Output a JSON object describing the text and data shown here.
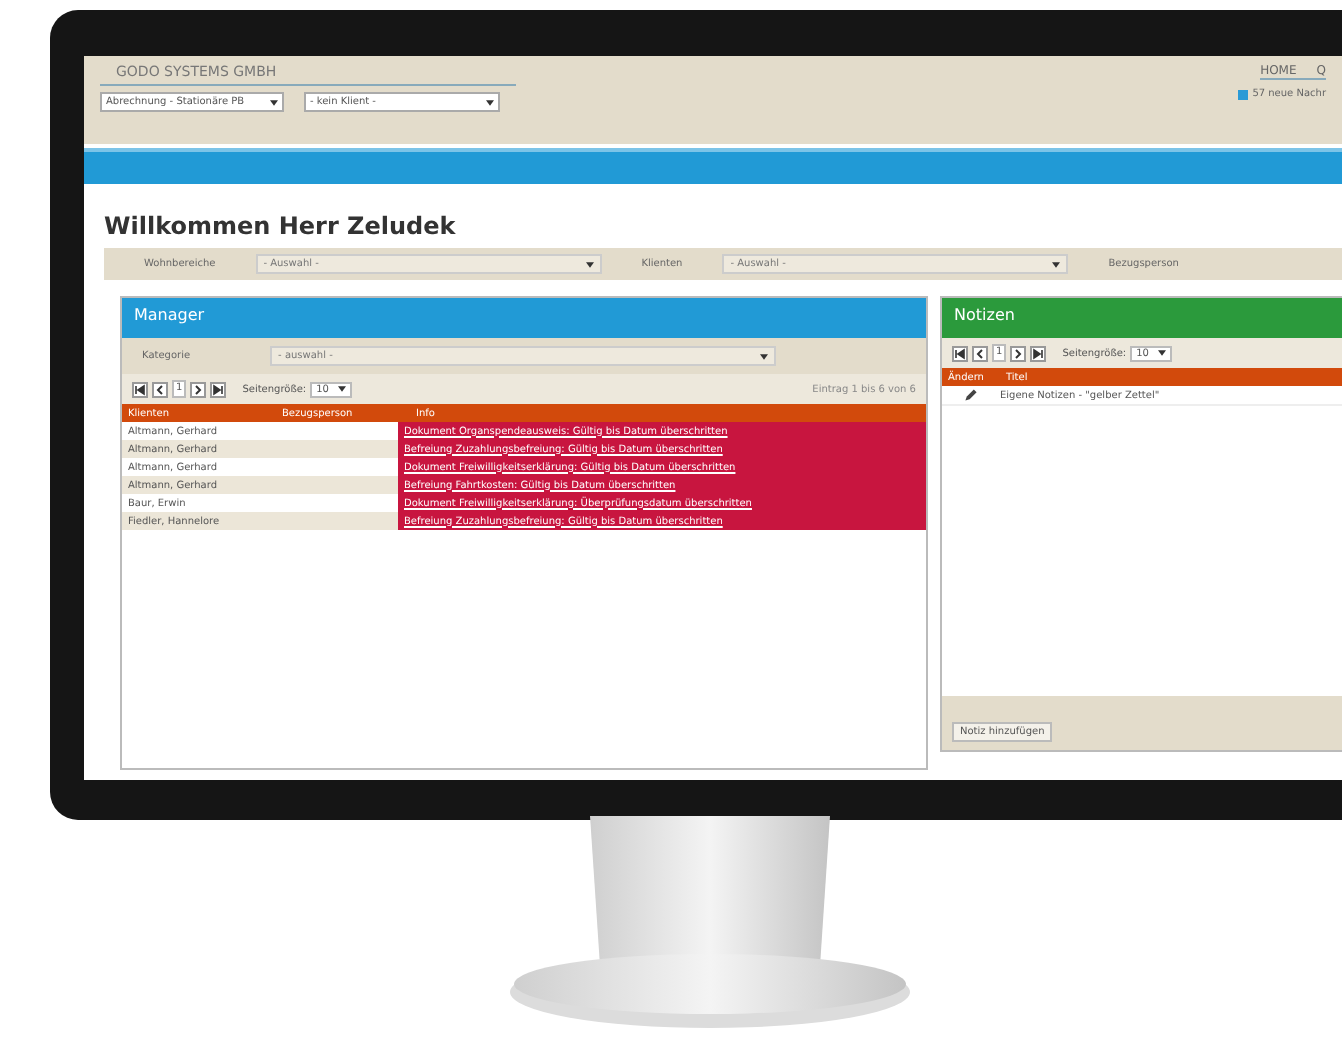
{
  "header": {
    "company": "GODO SYSTEMS GMBH",
    "selects": [
      "Abrechnung - Stationäre PB",
      "- kein Klient -"
    ],
    "nav": [
      "HOME",
      "Q"
    ],
    "messages": "57 neue Nachr"
  },
  "title": "Willkommen Herr Zeludek",
  "filters": [
    {
      "label": "Wohnbereiche",
      "value": "- Auswahl -"
    },
    {
      "label": "Klienten",
      "value": "- Auswahl -"
    },
    {
      "label": "Bezugsperson"
    }
  ],
  "manager": {
    "title": "Manager",
    "category_label": "Kategorie",
    "category_value": "- auswahl -",
    "page": "1",
    "page_size_label": "Seitengröße:",
    "page_size": "10",
    "summary": "Eintrag 1 bis 6 von 6",
    "columns": [
      "Klienten",
      "Bezugsperson",
      "Info"
    ],
    "rows": [
      {
        "client": "Altmann, Gerhard",
        "info": "Dokument Organspendeausweis: Gültig bis Datum überschritten"
      },
      {
        "client": "Altmann, Gerhard",
        "info": "Befreiung Zuzahlungsbefreiung: Gültig bis Datum überschritten"
      },
      {
        "client": "Altmann, Gerhard",
        "info": "Dokument Freiwilligkeitserklärung: Gültig bis Datum überschritten"
      },
      {
        "client": "Altmann, Gerhard",
        "info": "Befreiung Fahrtkosten: Gültig bis Datum überschritten"
      },
      {
        "client": "Baur, Erwin",
        "info": "Dokument Freiwilligkeitserklärung: Überprüfungsdatum überschritten"
      },
      {
        "client": "Fiedler, Hannelore",
        "info": "Befreiung Zuzahlungsbefreiung: Gültig bis Datum überschritten"
      }
    ]
  },
  "notes": {
    "title": "Notizen",
    "page": "1",
    "page_size_label": "Seitengröße:",
    "page_size": "10",
    "columns": [
      "Ändern",
      "Titel"
    ],
    "rows": [
      {
        "title": "Eigene Notizen - \"gelber Zettel\""
      }
    ],
    "add_button": "Notiz hinzufügen"
  }
}
